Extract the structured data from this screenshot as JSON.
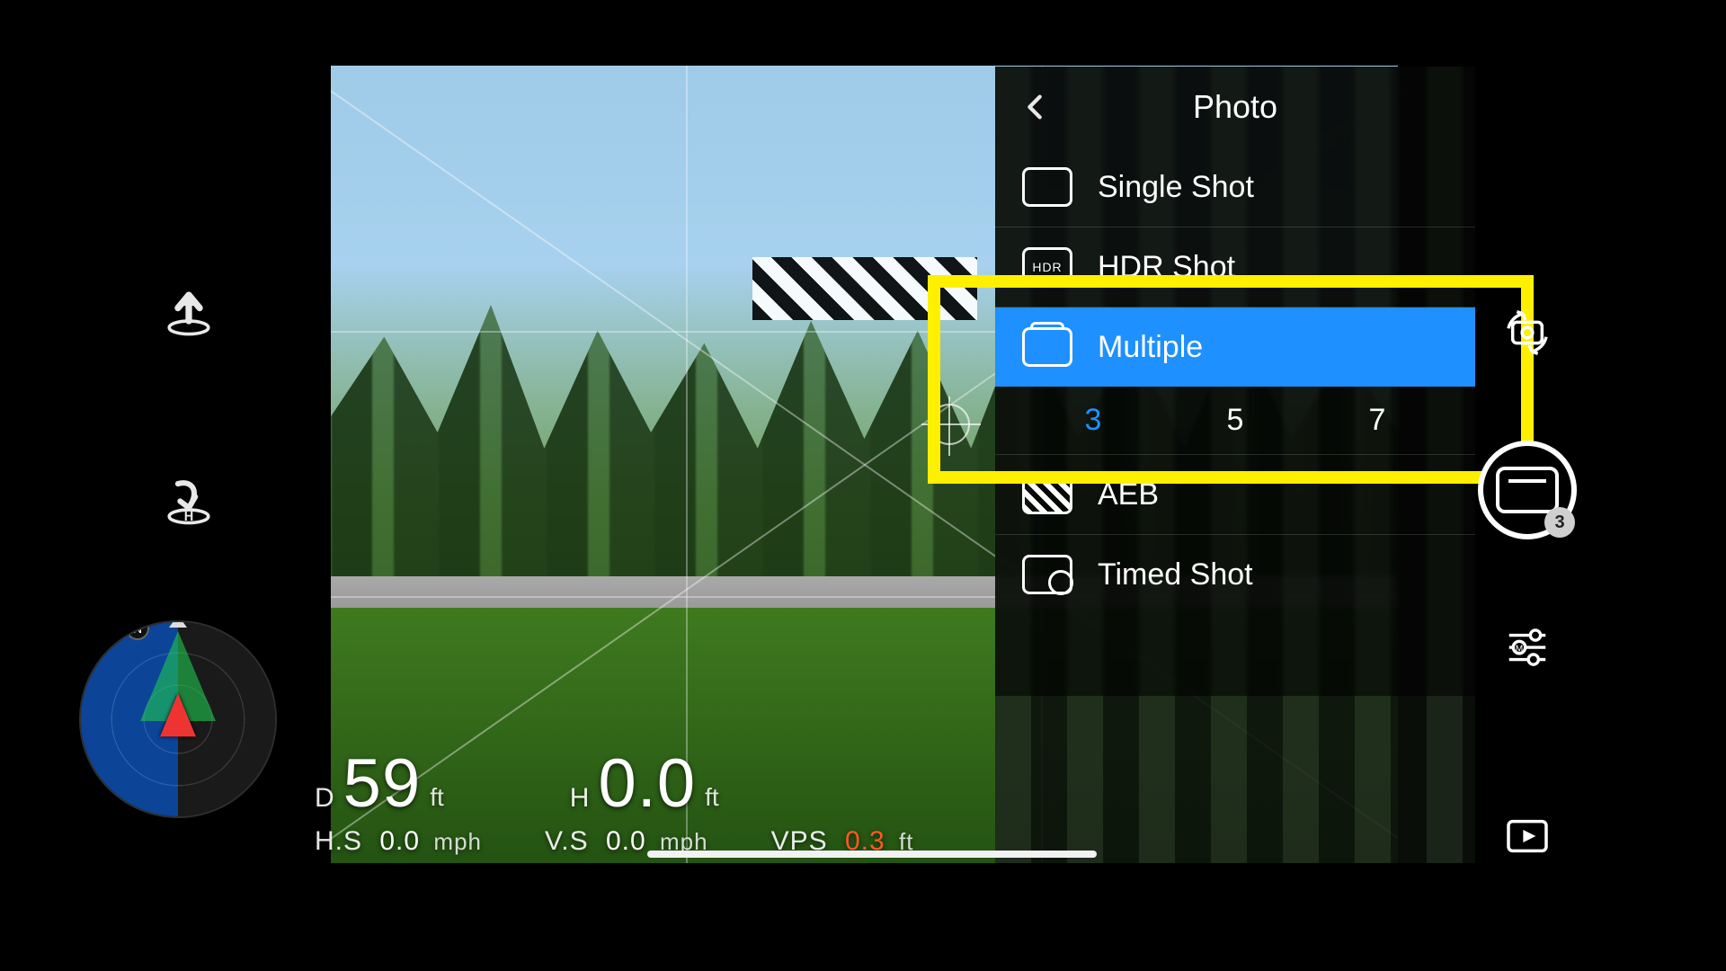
{
  "panel": {
    "title": "Photo",
    "back_icon": "chevron-left",
    "options": {
      "single": {
        "label": "Single Shot"
      },
      "hdr": {
        "label": "HDR Shot"
      },
      "multiple": {
        "label": "Multiple",
        "selected": true,
        "counts": [
          "3",
          "5",
          "7"
        ],
        "active_count": "3"
      },
      "aeb": {
        "label": "AEB"
      },
      "timed": {
        "label": "Timed Shot"
      }
    }
  },
  "telemetry": {
    "distance": {
      "label": "D",
      "value": "59",
      "unit": "ft"
    },
    "height": {
      "label": "H",
      "value": "0.0",
      "unit": "ft"
    },
    "hs": {
      "label": "H.S",
      "value": "0.0",
      "unit": "mph"
    },
    "vs": {
      "label": "V.S",
      "value": "0.0",
      "unit": "mph"
    },
    "vps": {
      "label": "VPS",
      "value": "0.3",
      "unit": "ft"
    }
  },
  "compass": {
    "north_label": "N"
  },
  "left_buttons": {
    "takeoff": "takeoff-icon",
    "rth": "return-home-icon"
  },
  "right_buttons": {
    "switch": "camera-switch-icon",
    "shutter_badge": "3",
    "settings": "settings-sliders-icon",
    "playback": "playback-icon"
  },
  "colors": {
    "accent": "#1e90ff",
    "warn": "#ff5a1f",
    "annot": "#ffef00"
  }
}
